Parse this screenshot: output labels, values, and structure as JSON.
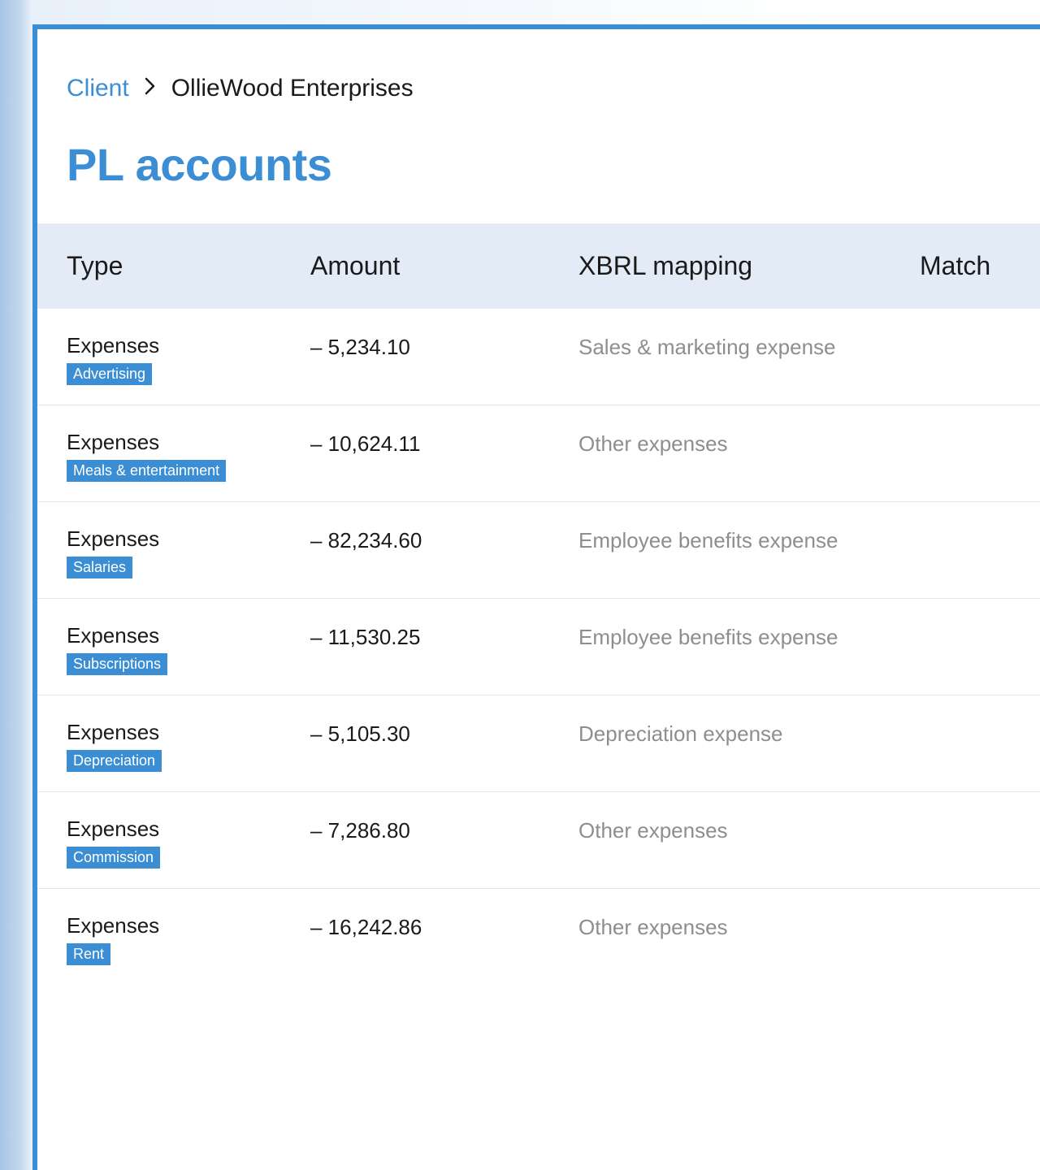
{
  "breadcrumb": {
    "root": "Client",
    "current": "OllieWood Enterprises"
  },
  "page_title": "PL accounts",
  "columns": {
    "type": "Type",
    "amount": "Amount",
    "mapping": "XBRL mapping",
    "match": "Match"
  },
  "rows": [
    {
      "type": "Expenses",
      "tag": "Advertising",
      "amount": "– 5,234.10",
      "mapping": "Sales & marketing expense"
    },
    {
      "type": "Expenses",
      "tag": "Meals & entertainment",
      "amount": "– 10,624.11",
      "mapping": "Other expenses"
    },
    {
      "type": "Expenses",
      "tag": "Salaries",
      "amount": "– 82,234.60",
      "mapping": "Employee benefits expense"
    },
    {
      "type": "Expenses",
      "tag": "Subscriptions",
      "amount": "– 11,530.25",
      "mapping": "Employee benefits expense"
    },
    {
      "type": "Expenses",
      "tag": "Depreciation",
      "amount": "– 5,105.30",
      "mapping": "Depreciation expense"
    },
    {
      "type": "Expenses",
      "tag": "Commission",
      "amount": "– 7,286.80",
      "mapping": "Other expenses"
    },
    {
      "type": "Expenses",
      "tag": "Rent",
      "amount": "– 16,242.86",
      "mapping": "Other expenses"
    }
  ]
}
